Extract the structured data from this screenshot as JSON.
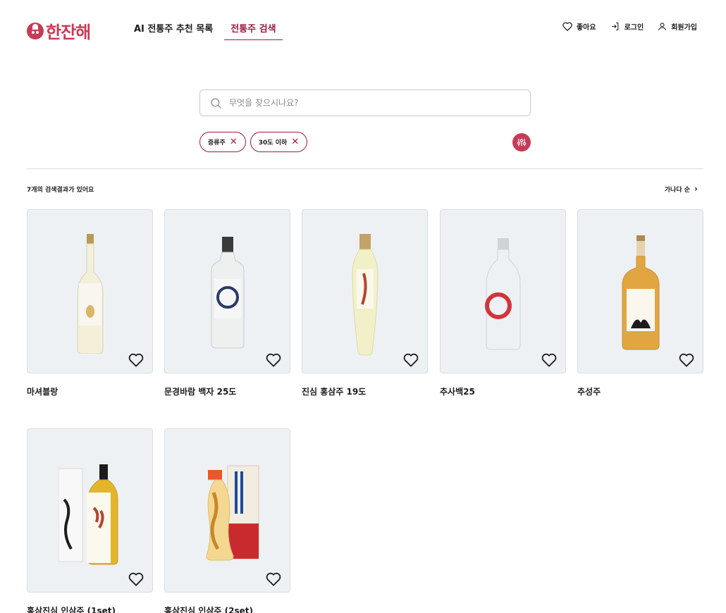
{
  "header": {
    "logo_text": "한잔해",
    "nav": [
      {
        "label": "AI 전통주 추천 목록",
        "active": false
      },
      {
        "label": "전통주 검색",
        "active": true
      }
    ],
    "right_links": [
      {
        "label": "좋아요",
        "icon": "heart-icon"
      },
      {
        "label": "로그인",
        "icon": "login-icon"
      },
      {
        "label": "회원가입",
        "icon": "user-icon"
      }
    ]
  },
  "search": {
    "placeholder": "무엇을 찾으시나요?",
    "value": ""
  },
  "filters": {
    "chips": [
      {
        "label": "증류주"
      },
      {
        "label": "30도 이하"
      }
    ]
  },
  "results": {
    "count_text": "7개의 검색결과가 있어요",
    "sort_label": "가나다 순",
    "items": [
      {
        "name": "마셔블랑"
      },
      {
        "name": "문경바람 백자 25도"
      },
      {
        "name": "진심 홍삼주 19도"
      },
      {
        "name": "추사백25"
      },
      {
        "name": "추성주"
      },
      {
        "name": "홍삼진심 인삼주 (1set)"
      },
      {
        "name": "홍삼진심 인삼주 (2set)"
      }
    ]
  },
  "colors": {
    "accent": "#c73b57",
    "accent_dark": "#9b1e3d",
    "card_bg": "#eef1f4"
  }
}
